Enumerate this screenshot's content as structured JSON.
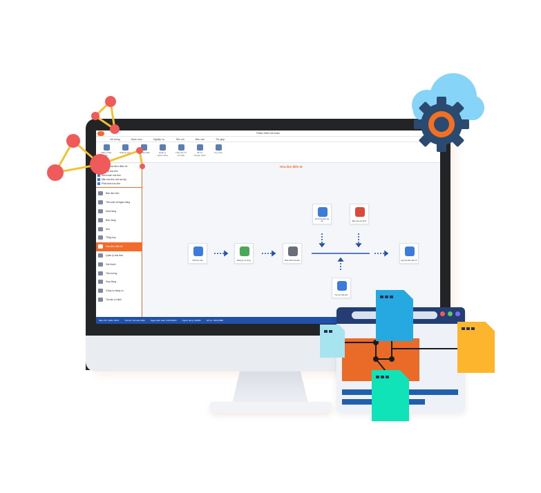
{
  "app": {
    "title": "Phần mềm kế toán",
    "menu": [
      "Hệ thống",
      "Danh mục",
      "Nghiệp vụ",
      "Tiện ích",
      "Báo cáo",
      "Trợ giúp"
    ],
    "ribbon": [
      {
        "label": "Đăng nhập lại",
        "icon": "user-refresh-icon"
      },
      {
        "label": "Nhật ký truy cập",
        "icon": "history-icon"
      },
      {
        "label": "Đổi mật khẩu",
        "icon": "key-icon"
      },
      {
        "label": "Quản lý người dùng",
        "icon": "users-icon"
      },
      {
        "label": "Thay đổi TT cá nhân",
        "icon": "id-card-icon"
      },
      {
        "label": "Vai trò chuyên trách",
        "icon": "role-icon"
      },
      {
        "label": "Tùy chọn",
        "icon": "settings-icon"
      }
    ]
  },
  "sidebar": {
    "header": "Hóa đơn điện tử",
    "sub_items": [
      "Quản lý hóa đơn",
      "Danh sách hóa đơn",
      "Mẫu hóa đơn mới tạo lập",
      "Phát hành hóa đơn"
    ],
    "items": [
      {
        "label": "Bàn làm việc",
        "icon": "desk-icon",
        "active": false
      },
      {
        "label": "Tiền mặt và Ngân hàng",
        "icon": "bank-icon",
        "active": false
      },
      {
        "label": "Mua hàng",
        "icon": "cart-icon",
        "active": false
      },
      {
        "label": "Bán hàng",
        "icon": "sale-icon",
        "active": false
      },
      {
        "label": "Kho",
        "icon": "warehouse-icon",
        "active": false
      },
      {
        "label": "Tổng hợp",
        "icon": "summary-icon",
        "active": false
      },
      {
        "label": "Hóa đơn điện tử",
        "icon": "invoice-icon",
        "active": true
      },
      {
        "label": "Quản lý hóa đơn",
        "icon": "invoice-manage-icon",
        "active": false
      },
      {
        "label": "Giá thành",
        "icon": "cost-icon",
        "active": false
      },
      {
        "label": "Tiền lương",
        "icon": "salary-icon",
        "active": false
      },
      {
        "label": "Hợp đồng",
        "icon": "contract-icon",
        "active": false
      },
      {
        "label": "Công cụ dụng cụ",
        "icon": "tools-icon",
        "active": false
      },
      {
        "label": "Tài sản cố định",
        "icon": "asset-icon",
        "active": false
      }
    ]
  },
  "content": {
    "title": "Hóa đơn điện tử",
    "nodes": [
      {
        "label": "Khởi tạo mẫu",
        "color": "#3d7dd8"
      },
      {
        "label": "Đăng ký sử dụng",
        "color": "#4aa85a"
      },
      {
        "label": "Phát hành hóa đơn",
        "color": "#6b6f78"
      },
      {
        "label": "Lập hóa đơn điện tử",
        "color": "#3d7dd8"
      },
      {
        "label": "Xử lý hóa đơn sai sót",
        "color": "#d94b3a"
      },
      {
        "label": "Báo cáo tình hình",
        "color": "#4aa85a"
      },
      {
        "label": "Tra cứu hóa đơn",
        "color": "#3d7dd8"
      }
    ]
  },
  "status": {
    "items": [
      "Máy chủ: CSDL TEST",
      "Thời kỳ: Kế toán 2024",
      "Ngày hạch toán: 01/01/2024",
      "Người dùng: ADMIN",
      "Hỗ trợ: 1900 6688"
    ]
  },
  "colors": {
    "accent": "#f26b2a",
    "statusbar": "#2150a8",
    "cloud": "#7ecff5",
    "gear": "#2b4a6f",
    "network_node": "#ef5b5b",
    "network_line": "#f2c230"
  }
}
